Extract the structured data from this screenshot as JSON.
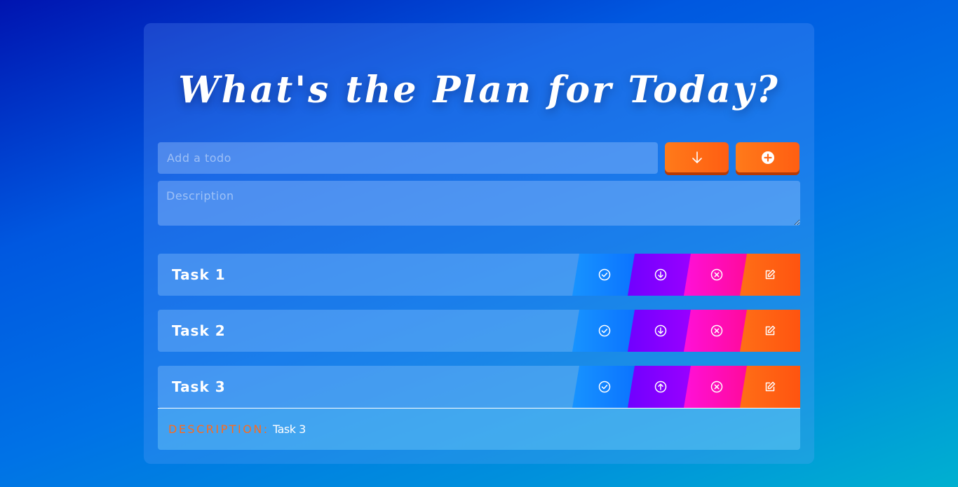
{
  "header": {
    "title": "What's the Plan for Today?"
  },
  "form": {
    "todo_placeholder": "Add a todo",
    "todo_value": "",
    "description_placeholder": "Description",
    "description_value": "",
    "expand_button_icon": "arrow-down-icon",
    "add_button_icon": "plus-circle-icon"
  },
  "tasks": [
    {
      "label": "Task 1",
      "expanded": false
    },
    {
      "label": "Task 2",
      "expanded": false
    },
    {
      "label": "Task 3",
      "expanded": true,
      "description_label": "DESCRIPTION:",
      "description": "Task 3"
    }
  ],
  "actions": {
    "done_icon": "check-circle-icon",
    "expand_icon": "arrow-down-circle-icon",
    "collapse_icon": "arrow-up-circle-icon",
    "delete_icon": "x-circle-icon",
    "edit_icon": "edit-icon"
  },
  "colors": {
    "accent_orange": "#ff6a1a",
    "done_blue": "#1793ff",
    "expand_purple": "#8000ff",
    "delete_pink": "#ff10c0"
  }
}
